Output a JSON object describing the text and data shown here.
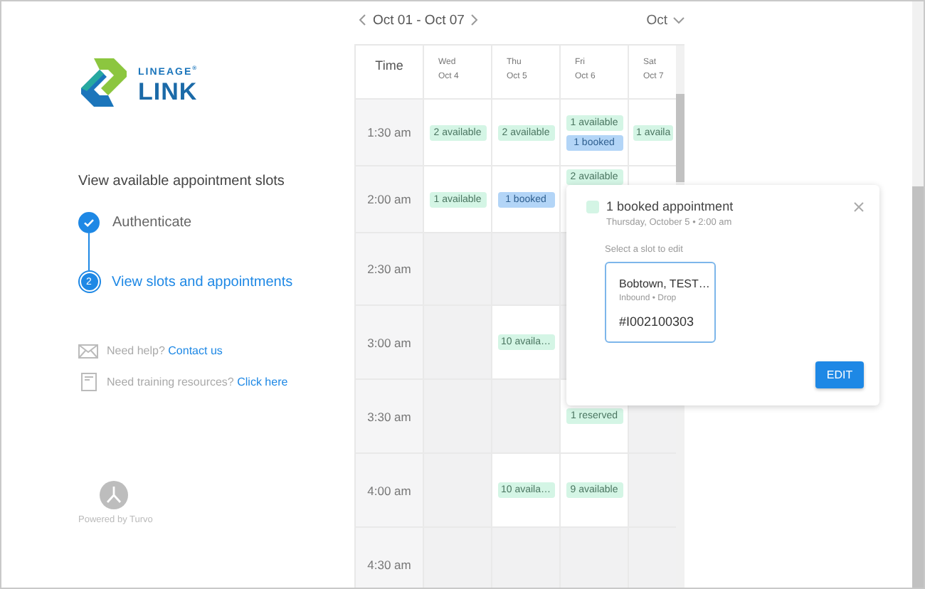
{
  "logo": {
    "brand_top": "LINEAGE$^{®}$",
    "brand_bottom": "LINK"
  },
  "steps_title": "View available appointment slots",
  "steps": [
    {
      "kind": "done",
      "label": "Authenticate",
      "selected": false
    },
    {
      "kind": "number",
      "number": "2",
      "label": "View slots and appointments",
      "selected": true
    }
  ],
  "help_links": [
    {
      "kind": "mail",
      "text": "Need help?",
      "link": "Contact us"
    },
    {
      "kind": "document",
      "text": "Need training resources?",
      "link": "Click here"
    }
  ],
  "powered_by": "Powered by Turvo",
  "calendar": {
    "range": "Oct 01 - Oct 07",
    "month": "Oct",
    "time_heading": "Time",
    "days": [
      {
        "name": "Wed",
        "date": "Oct 4"
      },
      {
        "name": "Thu",
        "date": "Oct 5"
      },
      {
        "name": "Fri",
        "date": "Oct 6"
      },
      {
        "name": "Sat",
        "date": "Oct 7"
      }
    ],
    "rows": [
      {
        "time": "1:30 am",
        "cells": [
          {
            "kind": "open",
            "slots": [
              {
                "kind": "available",
                "label": "2 available"
              }
            ]
          },
          {
            "kind": "open",
            "slots": [
              {
                "kind": "available",
                "label": "2 available"
              }
            ]
          },
          {
            "kind": "open",
            "slots": [
              {
                "kind": "available",
                "label": "1 available"
              },
              {
                "kind": "booked",
                "label": "1 booked"
              }
            ]
          },
          {
            "kind": "open",
            "slots": [
              {
                "kind": "available",
                "label": "1 availa"
              }
            ]
          }
        ]
      },
      {
        "time": "2:00 am",
        "cells": [
          {
            "kind": "open",
            "slots": [
              {
                "kind": "available",
                "label": "1 available"
              }
            ]
          },
          {
            "kind": "open",
            "slots": [
              {
                "kind": "booked",
                "label": "1 booked"
              }
            ]
          },
          {
            "kind": "full",
            "slots": [
              {
                "kind": "available",
                "label": "2 available"
              }
            ]
          },
          {
            "kind": "open"
          }
        ]
      },
      {
        "time": "2:30 am",
        "cells": [
          {
            "kind": "closed"
          },
          {
            "kind": "closed"
          },
          {},
          {}
        ]
      },
      {
        "time": "3:00 am",
        "cells": [
          {
            "kind": "closed"
          },
          {
            "kind": "open",
            "slots": [
              {
                "kind": "available",
                "label": "10 availa…"
              }
            ]
          },
          {},
          {}
        ]
      },
      {
        "time": "3:30 am",
        "cells": [
          {
            "kind": "closed"
          },
          {
            "kind": "closed"
          },
          {
            "kind": "open",
            "slots": [
              {
                "kind": "reserved",
                "label": "1 reserved"
              }
            ]
          },
          {
            "kind": "closed"
          }
        ]
      },
      {
        "time": "4:00 am",
        "cells": [
          {
            "kind": "closed"
          },
          {
            "kind": "open",
            "slots": [
              {
                "kind": "available",
                "label": "10 availa…"
              }
            ]
          },
          {
            "kind": "open",
            "slots": [
              {
                "kind": "available",
                "label": "9 available"
              }
            ]
          },
          {
            "kind": "closed"
          }
        ]
      },
      {
        "time": "4:30 am",
        "cells": [
          {
            "kind": "closed"
          },
          {
            "kind": "closed"
          },
          {
            "kind": "closed"
          },
          {
            "kind": "closed"
          }
        ]
      }
    ]
  },
  "popup": {
    "title": "1 booked appointment",
    "subtitle": "Thursday, October 5 • 2:00 am",
    "prompt": "Select a slot to edit",
    "slots": [
      {
        "title": "Bobtown, TEST…",
        "meta": "Inbound • Drop",
        "id": "#I002100303",
        "selected": true
      }
    ],
    "button": "EDIT"
  }
}
